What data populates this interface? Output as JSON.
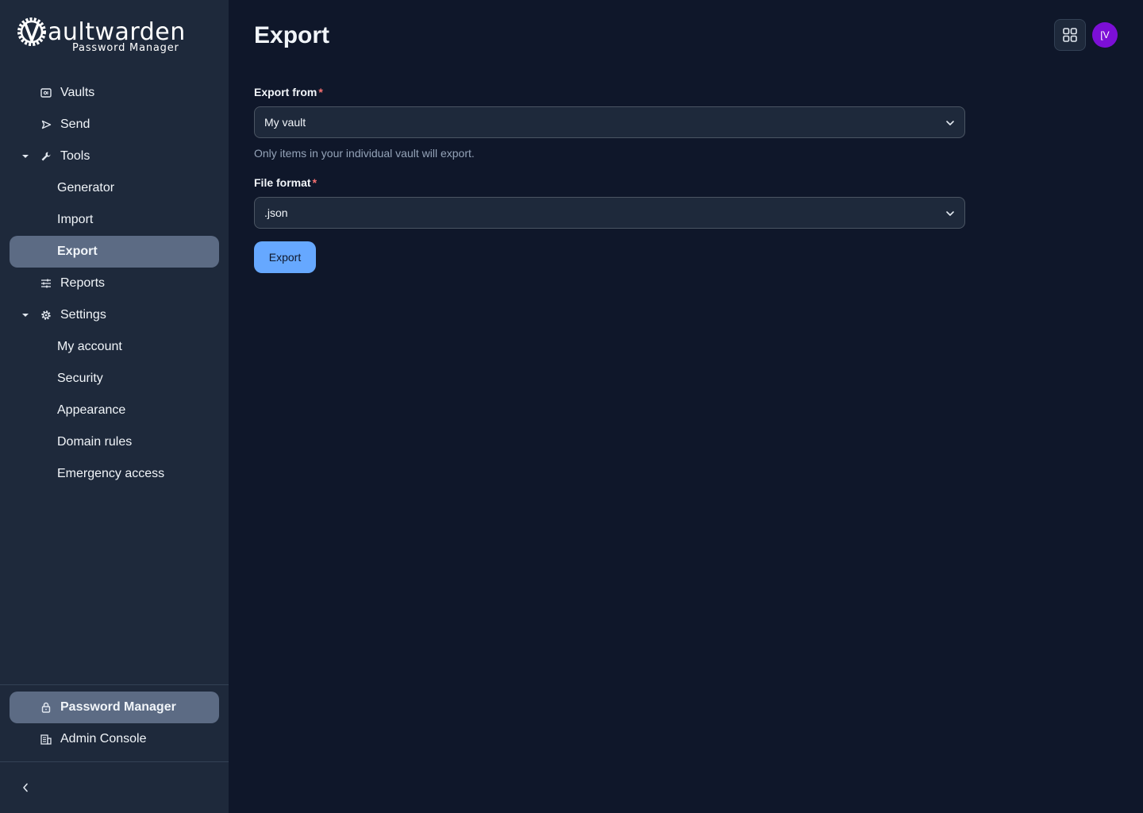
{
  "brand": {
    "word": "aultwarden",
    "sub": "Password Manager",
    "logo_icon": "vaultwarden-gear-logo-icon"
  },
  "sidebar": {
    "vaults": {
      "label": "Vaults",
      "icon": "vault-icon"
    },
    "send": {
      "label": "Send",
      "icon": "send-icon"
    },
    "tools": {
      "label": "Tools",
      "icon": "wrench-icon",
      "expanded": true,
      "children": {
        "generator": "Generator",
        "import": "Import",
        "export": "Export"
      }
    },
    "reports": {
      "label": "Reports",
      "icon": "sliders-icon"
    },
    "settings": {
      "label": "Settings",
      "icon": "gear-icon",
      "expanded": true,
      "children": {
        "my_account": "My account",
        "security": "Security",
        "appearance": "Appearance",
        "domain_rules": "Domain rules",
        "emergency_access": "Emergency access"
      }
    },
    "active_item": "Export",
    "products": {
      "password_manager": {
        "label": "Password Manager",
        "icon": "lock-icon",
        "active": true
      },
      "admin_console": {
        "label": "Admin Console",
        "icon": "building-icon"
      }
    }
  },
  "header": {
    "title": "Export",
    "avatar_initials": "[V",
    "apps_icon": "grid-icon"
  },
  "form": {
    "export_from": {
      "label": "Export from",
      "required": "*",
      "value": "My vault",
      "hint": "Only items in your individual vault will export."
    },
    "file_format": {
      "label": "File format",
      "required": "*",
      "value": ".json"
    },
    "submit_label": "Export"
  },
  "colors": {
    "accent": "#66a8ff",
    "active_nav": "#5c6b84",
    "avatar": "#7c0fd6",
    "background": "#0f172a",
    "sidebar": "#1e293b"
  }
}
